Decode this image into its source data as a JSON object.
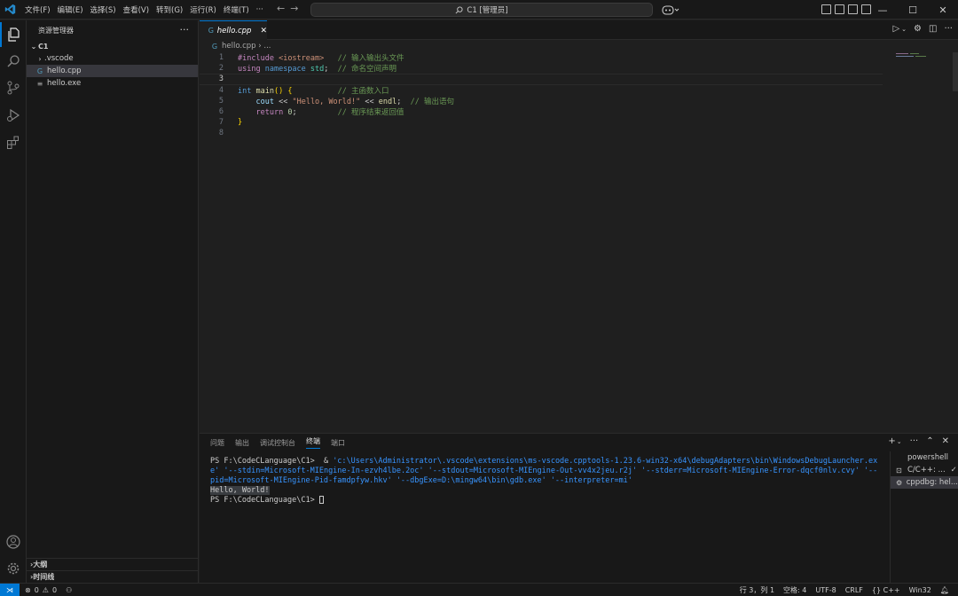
{
  "titlebar": {
    "menu": [
      "文件(F)",
      "编辑(E)",
      "选择(S)",
      "查看(V)",
      "转到(G)",
      "运行(R)",
      "终端(T)",
      "···"
    ],
    "command_center": "C1 [管理员]"
  },
  "sidebar": {
    "title": "资源管理器",
    "root": "C1",
    "items": [
      {
        "name": ".vscode",
        "kind": "folder"
      },
      {
        "name": "hello.cpp",
        "kind": "cpp",
        "selected": true
      },
      {
        "name": "hello.exe",
        "kind": "file"
      }
    ],
    "outline": "大纲",
    "timeline": "时间线"
  },
  "editor": {
    "tab_label": "hello.cpp",
    "breadcrumb_file": "hello.cpp",
    "breadcrumb_more": "...",
    "line_numbers": [
      "1",
      "2",
      "3",
      "4",
      "5",
      "6",
      "7",
      "8"
    ],
    "current_line": 3,
    "lines": {
      "l1_directive": "#include",
      "l1_header": "<iostream>",
      "l1_comment": "// 输入输出头文件",
      "l2_using": "using",
      "l2_namespace": "namespace",
      "l2_std": "std",
      "l2_semi": ";",
      "l2_comment": "// 命名空间声明",
      "l4_int": "int",
      "l4_main": "main",
      "l4_parens": "()",
      "l4_brace": "{",
      "l4_comment": "// 主函数入口",
      "l5_cout": "cout",
      "l5_op1": "<<",
      "l5_string": "\"Hello, World!\"",
      "l5_op2": "<<",
      "l5_endl": "endl",
      "l5_semi": ";",
      "l5_comment": "// 输出语句",
      "l6_return": "return",
      "l6_zero": "0",
      "l6_semi": ";",
      "l6_comment": "// 程序结束返回值",
      "l7_brace": "}"
    }
  },
  "panel": {
    "tabs": [
      "问题",
      "输出",
      "调试控制台",
      "终端",
      "端口"
    ],
    "active_tab": "终端",
    "terminal": {
      "prompt1": "PS F:\\CodeCLanguage\\C1> ",
      "cmd_amp": " & ",
      "cmd_launcher": "'c:\\Users\\Administrator\\.vscode\\extensions\\ms-vscode.cpptools-1.23.6-win32-x64\\debugAdapters\\bin\\WindowsDebugLauncher.exe'",
      "cmd_args": " '--stdin=Microsoft-MIEngine-In-ezvh4lbe.2oc' '--stdout=Microsoft-MIEngine-Out-vv4x2jeu.r2j' '--stderr=Microsoft-MIEngine-Error-dqcf0nlv.cvy' '--pid=Microsoft-MIEngine-Pid-famdpfyw.hkv' '--dbgExe=D:\\mingw64\\bin\\gdb.exe' '--interpreter=mi'",
      "output": "Hello, World!",
      "prompt2": "PS F:\\CodeCLanguage\\C1> "
    },
    "terminals": [
      "powershell",
      "C/C++: ...",
      "cppdbg: hel..."
    ]
  },
  "statusbar": {
    "errors": "0",
    "warnings": "0",
    "position": "行 3，列 1",
    "spaces": "空格: 4",
    "encoding": "UTF-8",
    "eol": "CRLF",
    "language": "C++",
    "platform": "Win32"
  },
  "colors": {
    "accent": "#0078d4",
    "background": "#1f1f1f",
    "sidebar": "#181818"
  }
}
